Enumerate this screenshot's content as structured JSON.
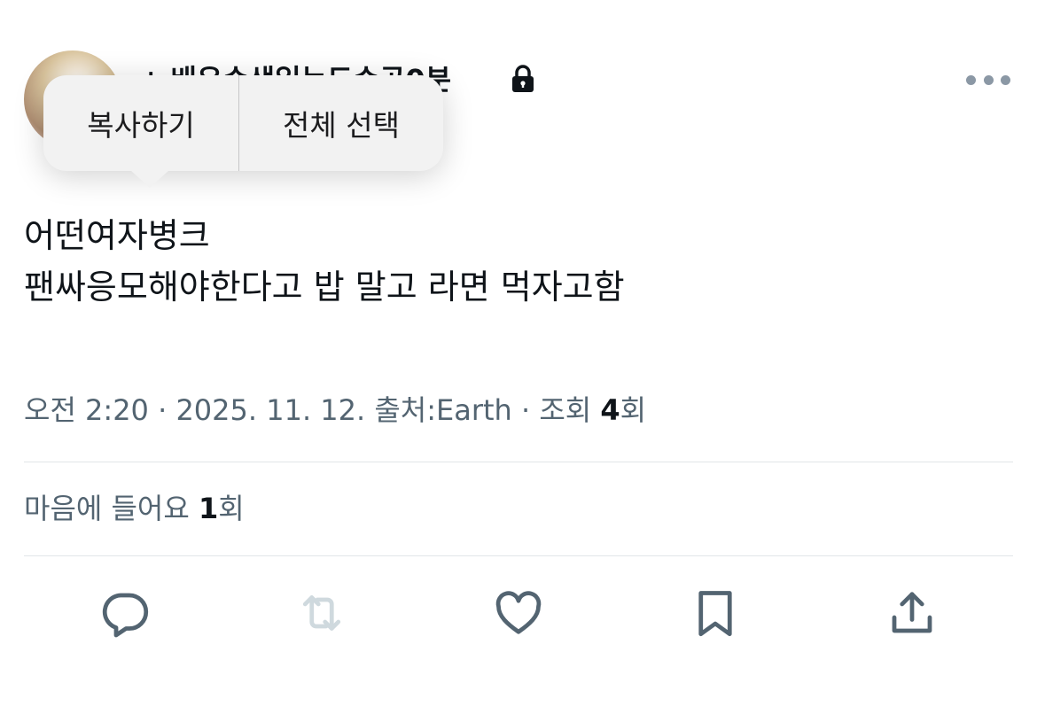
{
  "author": {
    "display_name": "ㄴ배우순생일눈도순공0분",
    "lock_icon": "lock-icon",
    "avatar_icon": "avatar"
  },
  "context_menu": {
    "copy_label": "복사하기",
    "select_all_label": "전체 선택"
  },
  "tweet": {
    "lines": [
      "어떤여자병크",
      "팬싸응모해야한다고 밥 말고 라면 먹자고함"
    ]
  },
  "meta": {
    "time": "오전 2:20",
    "date": "2025. 11. 12.",
    "source_prefix": "출처:",
    "source": "Earth",
    "views_prefix": "조회",
    "views_count": "4",
    "views_suffix": "회",
    "separator": "·"
  },
  "likes": {
    "prefix": "마음에 들어요",
    "count": "1",
    "suffix": "회"
  },
  "actions": {
    "reply": "reply-icon",
    "retweet": "retweet-icon",
    "like": "heart-icon",
    "bookmark": "bookmark-icon",
    "share": "share-icon"
  },
  "colors": {
    "text": "#0f1419",
    "muted": "#536471",
    "icon": "#536471",
    "disabled_icon": "#cfd9de",
    "menu_bg": "#f2f2f2"
  }
}
